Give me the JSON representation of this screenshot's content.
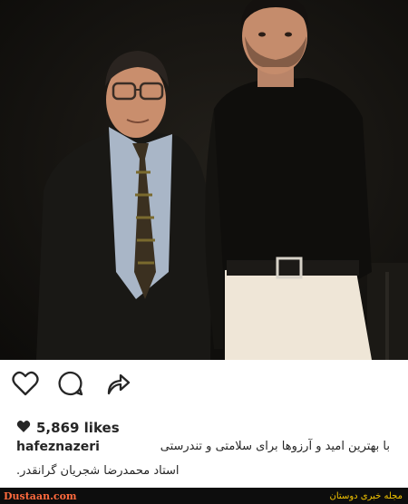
{
  "post": {
    "image_alt": "Two men posing for a portrait: an older man in glasses, suit and patterned tie beside a taller young man in a dark shirt and white trousers",
    "likes_count": "5,869 likes",
    "caption_user": "hafeznazeri",
    "caption_line1": "با بهترین امید و آرزوها برای سلامتی و تندرستی",
    "caption_line2": "استاد محمدرضا شجریان گرانقدر."
  },
  "actions": {
    "like_icon": "heart-outline-icon",
    "comment_icon": "comment-bubble-icon",
    "share_icon": "share-arrow-icon"
  },
  "footer": {
    "site": "Dustaan.com",
    "tagline": "مجله خبری دوستان"
  },
  "colors": {
    "text": "#262626",
    "footer_bg": "#0d0d0d",
    "footer_site": "#ff6a3d",
    "footer_tagline": "#f2c400"
  }
}
